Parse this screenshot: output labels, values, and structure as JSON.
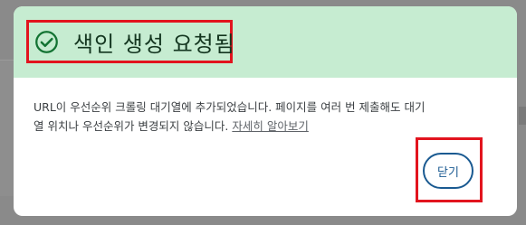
{
  "dialog": {
    "title": "색인 생성 요청됨",
    "message_line1": "URL이 우선순위 크롤링 대기열에 추가되었습니다. 페이지를 여러 번 제출해도 대기",
    "message_line2": "열 위치나 우선순위가 변경되지 않습니다.",
    "learn_more": "자세히 알아보기",
    "close_label": "닫기",
    "icon": "check-circle-icon"
  },
  "colors": {
    "header_bg": "#c6ecd1",
    "accent": "#1a5a91",
    "highlight": "#e2141e",
    "check": "#137333"
  }
}
